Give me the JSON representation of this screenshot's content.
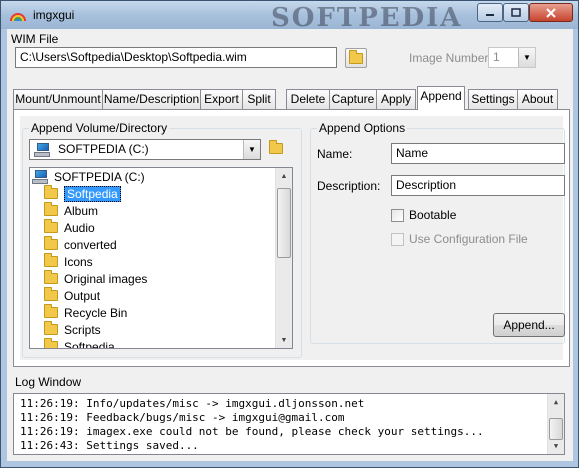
{
  "window": {
    "title": "imgxgui",
    "watermark": "SOFTPEDIA"
  },
  "wim": {
    "label": "WIM File",
    "path": "C:\\Users\\Softpedia\\Desktop\\Softpedia.wim",
    "image_number_label": "Image Number:",
    "image_number_value": "1"
  },
  "tabs": [
    "Mount/Unmount",
    "Name/Description",
    "Export",
    "Split",
    "Delete",
    "Capture",
    "Apply",
    "Append",
    "Settings",
    "About"
  ],
  "append": {
    "volume_group_label": "Append Volume/Directory",
    "drive_combo_value": "SOFTPEDIA (C:)",
    "tree_root": "SOFTPEDIA (C:)",
    "folders": [
      "Softpedia",
      "Album",
      "Audio",
      "converted",
      "Icons",
      "Original images",
      "Output",
      "Recycle Bin",
      "Scripts",
      "Softpedia"
    ],
    "options_group_label": "Append Options",
    "name_label": "Name:",
    "name_value": "Name",
    "description_label": "Description:",
    "description_value": "Description",
    "bootable_label": "Bootable",
    "use_config_label": "Use Configuration File",
    "append_button": "Append..."
  },
  "log": {
    "label": "Log Window",
    "lines": [
      "11:26:19: Info/updates/misc -> imgxgui.dljonsson.net",
      "11:26:19: Feedback/bugs/misc -> imgxgui@gmail.com",
      "11:26:19: imagex.exe could not be found, please check your settings...",
      "11:26:43: Settings saved..."
    ]
  },
  "colors": {
    "selection": "#3399ff",
    "titlebar": "#a7c0dc",
    "close_button": "#c7442d"
  }
}
